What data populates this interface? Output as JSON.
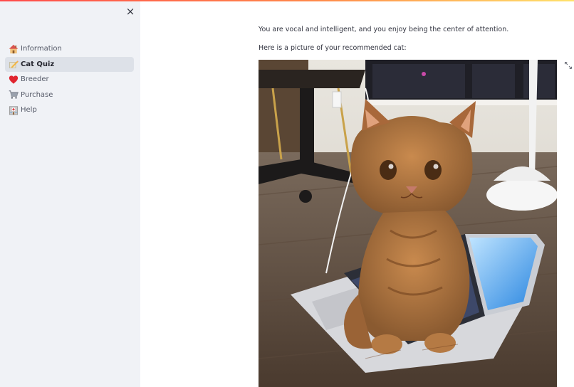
{
  "sidebar": {
    "close_label": "×",
    "items": [
      {
        "label": "Information",
        "icon": "house-icon",
        "active": false
      },
      {
        "label": "Cat Quiz",
        "icon": "memo-pencil-icon",
        "active": true
      },
      {
        "label": "Breeder",
        "icon": "heart-icon",
        "active": false
      },
      {
        "label": "Purchase",
        "icon": "shopping-cart-icon",
        "active": false
      },
      {
        "label": "Help",
        "icon": "hospital-icon",
        "active": false
      }
    ]
  },
  "main": {
    "result_text": "You are vocal and intelligent, and you enjoy being the center of attention.",
    "picture_caption": "Here is a picture of your recommended cat:",
    "image": {
      "alt": "cat sitting on laptop",
      "subject": "orange tabby cat sitting on an open laptop"
    }
  },
  "colors": {
    "sidebar_bg": "#f0f2f6",
    "active_item_bg": "#dde1e8",
    "accent": "#ff4b4b"
  }
}
